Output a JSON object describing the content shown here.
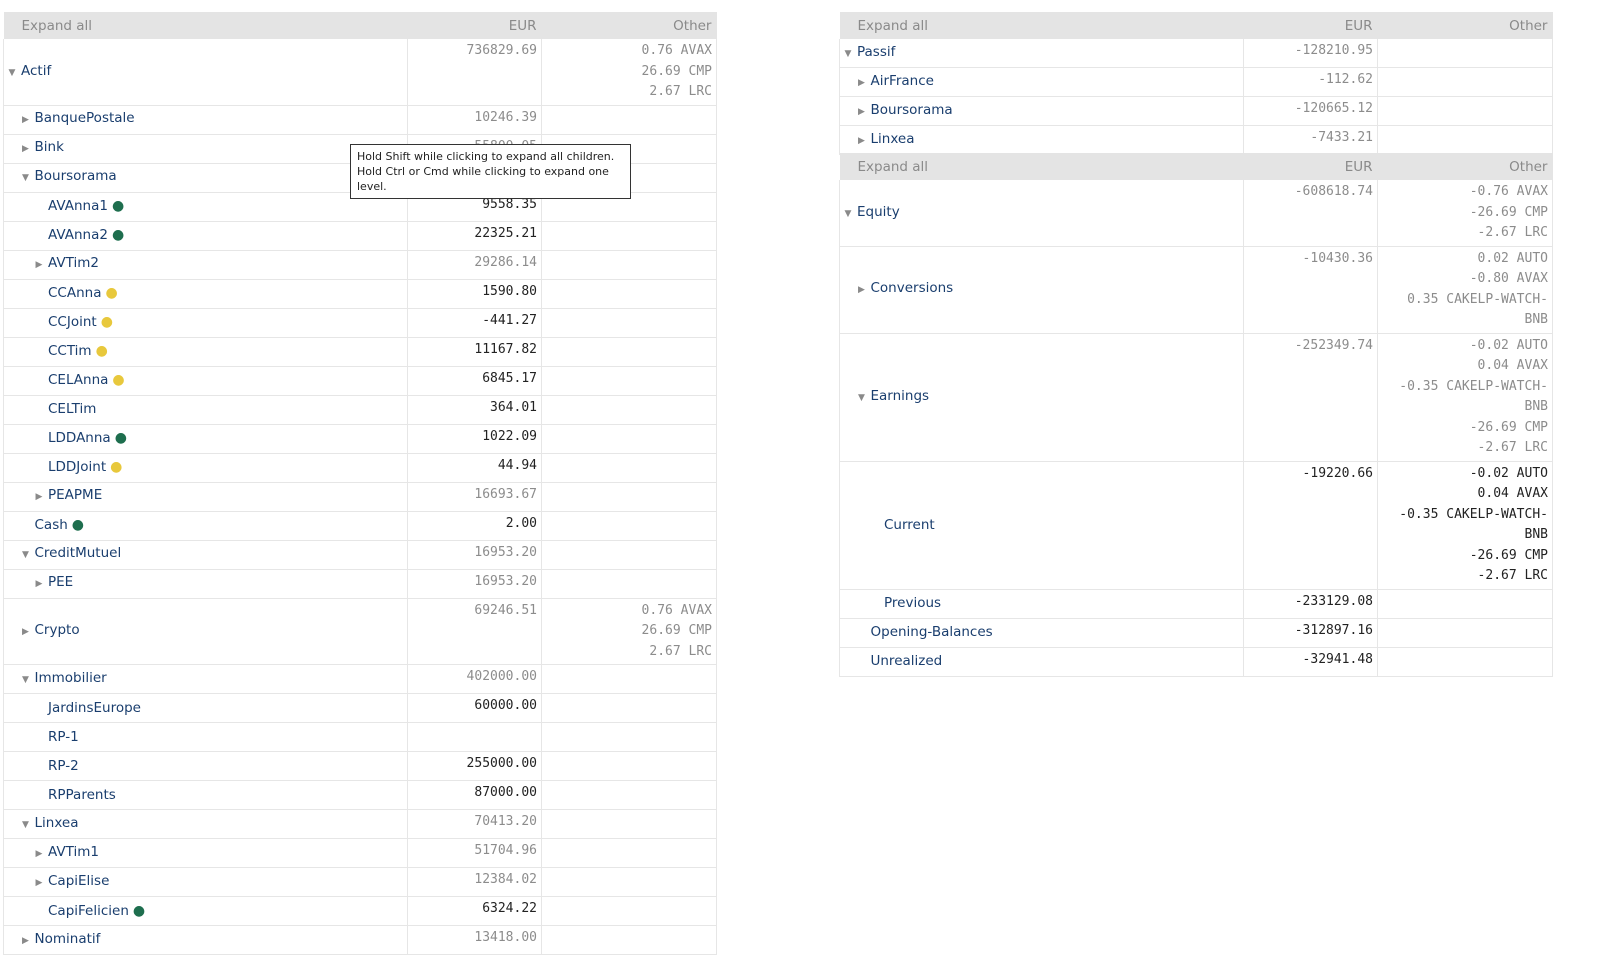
{
  "colors": {
    "header_bg": "#e4e4e4",
    "label": "#1a3e6e",
    "muted": "#8c8c8c",
    "dot_green": "#1e6e4e",
    "dot_yellow": "#e8c83c"
  },
  "tooltip": {
    "line1": "Hold Shift while clicking to expand all children.",
    "line2": "Hold Ctrl or Cmd while clicking to expand one level."
  },
  "tables": [
    {
      "id": "panel-left",
      "columns": [
        "Expand all",
        "EUR",
        "Other"
      ],
      "col_widths": [
        404,
        134,
        175
      ],
      "rows": [
        {
          "name": "Actif",
          "level": 0,
          "toggle": "open",
          "eur": "736829.69",
          "eur_style": "muted",
          "other": [
            "0.76 AVAX",
            "26.69 CMP",
            "2.67 LRC"
          ]
        },
        {
          "name": "BanquePostale",
          "level": 1,
          "toggle": "closed",
          "eur": "10246.39",
          "eur_style": "muted",
          "other": []
        },
        {
          "name": "Bink",
          "level": 1,
          "toggle": "closed",
          "eur": "55800.05",
          "eur_style": "muted",
          "other": []
        },
        {
          "name": "Boursorama",
          "level": 1,
          "toggle": "open",
          "eur": "",
          "eur_style": "muted",
          "other": []
        },
        {
          "name": "AVAnna1",
          "level": 2,
          "toggle": "none",
          "dot": "green",
          "eur": "9558.35",
          "eur_style": "strong",
          "other": []
        },
        {
          "name": "AVAnna2",
          "level": 2,
          "toggle": "none",
          "dot": "green",
          "eur": "22325.21",
          "eur_style": "strong",
          "other": []
        },
        {
          "name": "AVTim2",
          "level": 2,
          "toggle": "closed",
          "eur": "29286.14",
          "eur_style": "muted",
          "other": []
        },
        {
          "name": "CCAnna",
          "level": 2,
          "toggle": "none",
          "dot": "yellow",
          "eur": "1590.80",
          "eur_style": "strong",
          "other": []
        },
        {
          "name": "CCJoint",
          "level": 2,
          "toggle": "none",
          "dot": "yellow",
          "eur": "-441.27",
          "eur_style": "strong",
          "other": []
        },
        {
          "name": "CCTim",
          "level": 2,
          "toggle": "none",
          "dot": "yellow",
          "eur": "11167.82",
          "eur_style": "strong",
          "other": []
        },
        {
          "name": "CELAnna",
          "level": 2,
          "toggle": "none",
          "dot": "yellow",
          "eur": "6845.17",
          "eur_style": "strong",
          "other": []
        },
        {
          "name": "CELTim",
          "level": 2,
          "toggle": "none",
          "eur": "364.01",
          "eur_style": "strong",
          "other": []
        },
        {
          "name": "LDDAnna",
          "level": 2,
          "toggle": "none",
          "dot": "green",
          "eur": "1022.09",
          "eur_style": "strong",
          "other": []
        },
        {
          "name": "LDDJoint",
          "level": 2,
          "toggle": "none",
          "dot": "yellow",
          "eur": "44.94",
          "eur_style": "strong",
          "other": []
        },
        {
          "name": "PEAPME",
          "level": 2,
          "toggle": "closed",
          "eur": "16693.67",
          "eur_style": "muted",
          "other": []
        },
        {
          "name": "Cash",
          "level": 1,
          "toggle": "none",
          "dot": "green",
          "eur": "2.00",
          "eur_style": "strong",
          "other": []
        },
        {
          "name": "CreditMutuel",
          "level": 1,
          "toggle": "open",
          "eur": "16953.20",
          "eur_style": "muted",
          "other": []
        },
        {
          "name": "PEE",
          "level": 2,
          "toggle": "closed",
          "eur": "16953.20",
          "eur_style": "muted",
          "other": []
        },
        {
          "name": "Crypto",
          "level": 1,
          "toggle": "closed",
          "eur": "69246.51",
          "eur_style": "muted",
          "other": [
            "0.76 AVAX",
            "26.69 CMP",
            "2.67 LRC"
          ]
        },
        {
          "name": "Immobilier",
          "level": 1,
          "toggle": "open",
          "eur": "402000.00",
          "eur_style": "muted",
          "other": []
        },
        {
          "name": "JardinsEurope",
          "level": 2,
          "toggle": "none",
          "eur": "60000.00",
          "eur_style": "strong",
          "other": []
        },
        {
          "name": "RP-1",
          "level": 2,
          "toggle": "none",
          "eur": "",
          "eur_style": "strong",
          "other": []
        },
        {
          "name": "RP-2",
          "level": 2,
          "toggle": "none",
          "eur": "255000.00",
          "eur_style": "strong",
          "other": []
        },
        {
          "name": "RPParents",
          "level": 2,
          "toggle": "none",
          "eur": "87000.00",
          "eur_style": "strong",
          "other": []
        },
        {
          "name": "Linxea",
          "level": 1,
          "toggle": "open",
          "eur": "70413.20",
          "eur_style": "muted",
          "other": []
        },
        {
          "name": "AVTim1",
          "level": 2,
          "toggle": "closed",
          "eur": "51704.96",
          "eur_style": "muted",
          "other": []
        },
        {
          "name": "CapiElise",
          "level": 2,
          "toggle": "closed",
          "eur": "12384.02",
          "eur_style": "muted",
          "other": []
        },
        {
          "name": "CapiFelicien",
          "level": 2,
          "toggle": "none",
          "dot": "green",
          "eur": "6324.22",
          "eur_style": "strong",
          "other": []
        },
        {
          "name": "Nominatif",
          "level": 1,
          "toggle": "closed",
          "eur": "13418.00",
          "eur_style": "muted",
          "other": []
        }
      ]
    },
    {
      "id": "panel-passif",
      "columns": [
        "Expand all",
        "EUR",
        "Other"
      ],
      "col_widths": [
        404,
        134,
        175
      ],
      "rows": [
        {
          "name": "Passif",
          "level": 0,
          "toggle": "open",
          "eur": "-128210.95",
          "eur_style": "muted",
          "other": []
        },
        {
          "name": "AirFrance",
          "level": 1,
          "toggle": "closed",
          "eur": "-112.62",
          "eur_style": "muted",
          "other": []
        },
        {
          "name": "Boursorama",
          "level": 1,
          "toggle": "closed",
          "eur": "-120665.12",
          "eur_style": "muted",
          "other": []
        },
        {
          "name": "Linxea",
          "level": 1,
          "toggle": "closed",
          "eur": "-7433.21",
          "eur_style": "muted",
          "other": []
        }
      ]
    },
    {
      "id": "panel-equity",
      "columns": [
        "Expand all",
        "EUR",
        "Other"
      ],
      "col_widths": [
        404,
        134,
        175
      ],
      "rows": [
        {
          "name": "Equity",
          "level": 0,
          "toggle": "open",
          "eur": "-608618.74",
          "eur_style": "muted",
          "other": [
            "-0.76 AVAX",
            "-26.69 CMP",
            "-2.67 LRC"
          ]
        },
        {
          "name": "Conversions",
          "level": 1,
          "toggle": "closed",
          "eur": "-10430.36",
          "eur_style": "muted",
          "other": [
            "0.02 AUTO",
            "-0.80 AVAX",
            "0.35 CAKELP-WATCH-",
            "BNB"
          ]
        },
        {
          "name": "Earnings",
          "level": 1,
          "toggle": "open",
          "eur": "-252349.74",
          "eur_style": "muted",
          "other": [
            "-0.02 AUTO",
            "0.04 AVAX",
            "-0.35 CAKELP-WATCH-",
            "BNB",
            "-26.69 CMP",
            "-2.67 LRC"
          ]
        },
        {
          "name": "Current",
          "level": 2,
          "toggle": "none",
          "eur": "-19220.66",
          "eur_style": "strong",
          "other": [
            "-0.02 AUTO",
            "0.04 AVAX",
            "-0.35 CAKELP-WATCH-",
            "BNB",
            "-26.69 CMP",
            "-2.67 LRC"
          ],
          "other_style": "strong"
        },
        {
          "name": "Previous",
          "level": 2,
          "toggle": "none",
          "eur": "-233129.08",
          "eur_style": "strong",
          "other": []
        },
        {
          "name": "Opening-Balances",
          "level": 1,
          "toggle": "none",
          "eur": "-312897.16",
          "eur_style": "strong",
          "other": []
        },
        {
          "name": "Unrealized",
          "level": 1,
          "toggle": "none",
          "eur": "-32941.48",
          "eur_style": "strong",
          "other": []
        }
      ]
    }
  ]
}
